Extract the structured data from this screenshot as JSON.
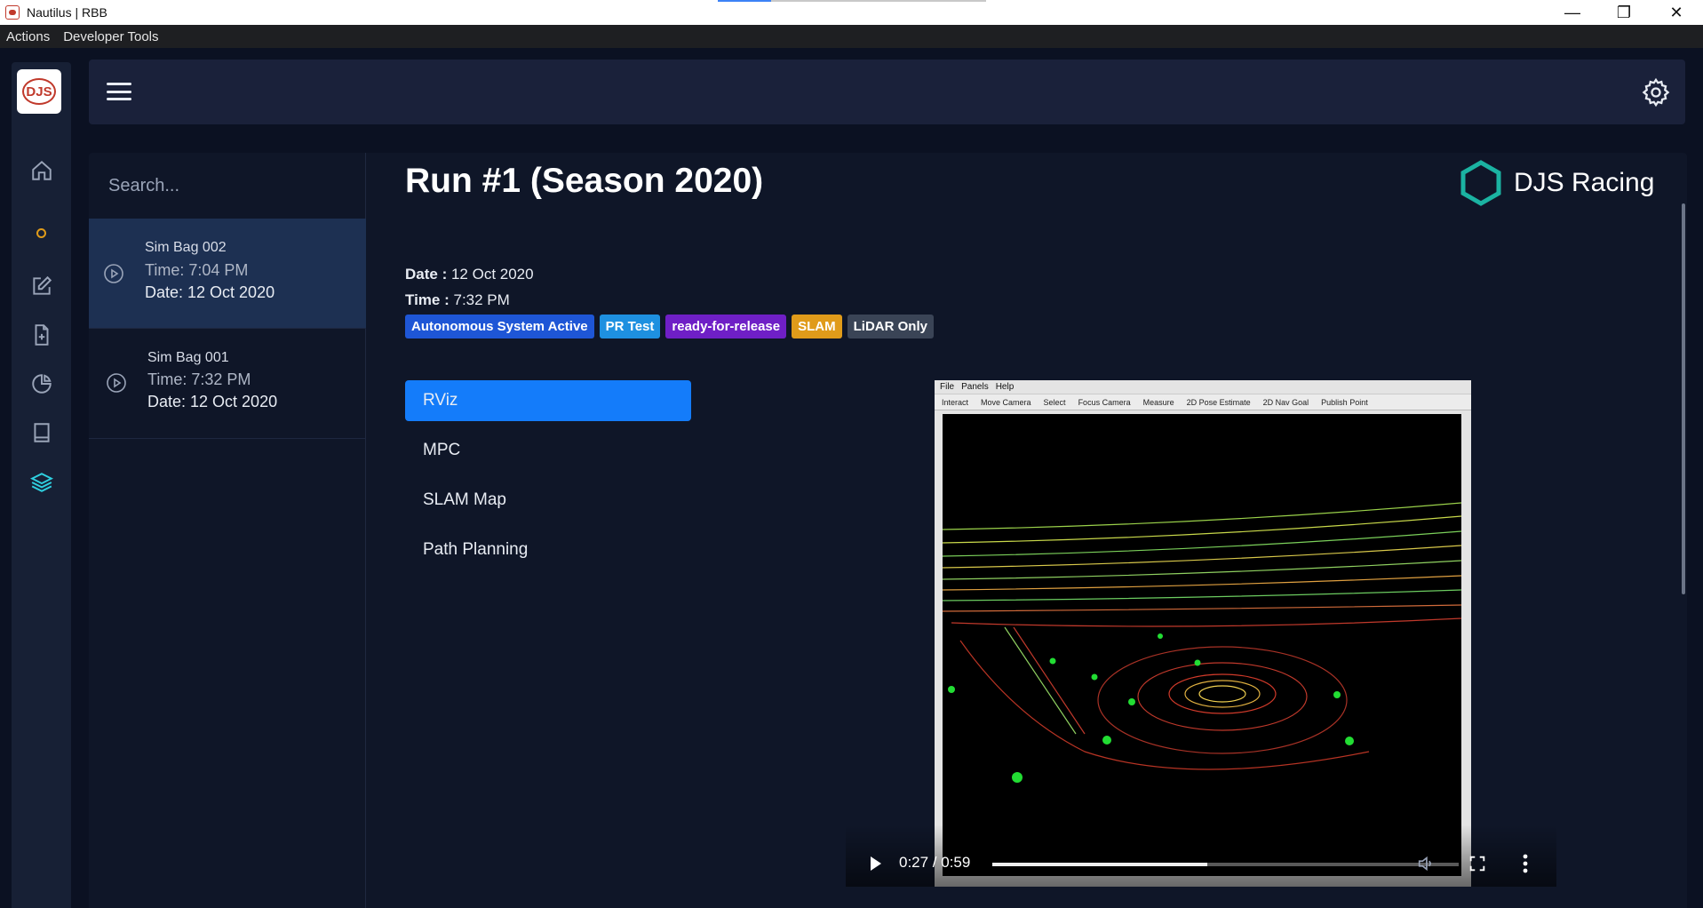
{
  "window": {
    "title": "Nautilus | RBB"
  },
  "menubar": {
    "items": [
      "Actions",
      "Developer Tools"
    ]
  },
  "sidebar": {
    "logo_icon": "djs-logo-icon",
    "items": [
      {
        "icon": "home-icon"
      },
      {
        "icon": "status-dot-icon"
      },
      {
        "icon": "edit-icon"
      },
      {
        "icon": "add-file-icon"
      },
      {
        "icon": "pie-chart-icon"
      },
      {
        "icon": "book-icon"
      },
      {
        "icon": "layers-icon",
        "active": true
      }
    ]
  },
  "header": {
    "menu_icon": "hamburger-icon",
    "settings_icon": "gear-icon"
  },
  "search": {
    "placeholder": "Search..."
  },
  "bags": [
    {
      "name": "Sim Bag 002",
      "time": "Time: 7:04 PM",
      "date": "Date: 12 Oct 2020",
      "active": true
    },
    {
      "name": "Sim Bag 001",
      "time": "Time: 7:32 PM",
      "date": "Date: 12 Oct 2020",
      "active": false
    }
  ],
  "run": {
    "title": "Run #1 (Season 2020)",
    "date_label": "Date :",
    "date_value": "12 Oct 2020",
    "time_label": "Time :",
    "time_value": "7:32 PM"
  },
  "team": {
    "name": "DJS Racing",
    "icon": "hexagon-icon",
    "color": "#1bb3a2"
  },
  "tags": [
    {
      "label": "Autonomous System Active",
      "color": "#1e56d6"
    },
    {
      "label": "PR Test",
      "color": "#1e90e0"
    },
    {
      "label": "ready-for-release",
      "color": "#6f1fc6"
    },
    {
      "label": "SLAM",
      "color": "#e09b1a"
    },
    {
      "label": "LiDAR Only",
      "color": "#3a4456"
    }
  ],
  "tabs": [
    {
      "label": "RViz",
      "active": true
    },
    {
      "label": "MPC",
      "active": false
    },
    {
      "label": "SLAM Map",
      "active": false
    },
    {
      "label": "Path Planning",
      "active": false
    }
  ],
  "video": {
    "time": "0:27 / 0:59",
    "progress": 0.46,
    "rviz_menu": [
      "File",
      "Panels",
      "Help"
    ],
    "rviz_tools": [
      "Interact",
      "Move Camera",
      "Select",
      "Focus Camera",
      "Measure",
      "2D Pose Estimate",
      "2D Nav Goal",
      "Publish Point"
    ]
  },
  "colors": {
    "accent": "#147cfa",
    "active_bag": "#1d3052"
  }
}
